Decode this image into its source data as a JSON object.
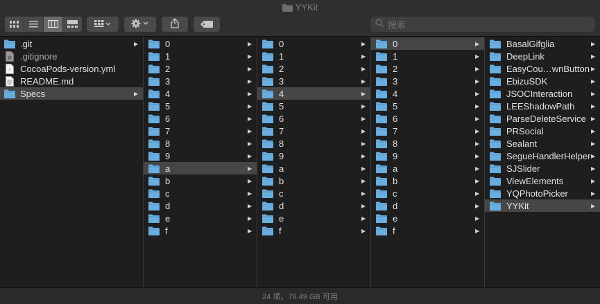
{
  "window": {
    "title": "YYKit"
  },
  "search": {
    "placeholder": "搜索"
  },
  "status": {
    "text": "24 项，76.49 GB 可用"
  },
  "columns": [
    {
      "items": [
        {
          "label": ".git",
          "type": "folder",
          "arrow": true,
          "dim": false,
          "selected": false
        },
        {
          "label": ".gitignore",
          "type": "hidden-file",
          "arrow": false,
          "dim": true,
          "selected": false
        },
        {
          "label": "CocoaPods-version.yml",
          "type": "file",
          "arrow": false,
          "dim": false,
          "selected": false
        },
        {
          "label": "README.md",
          "type": "doc",
          "arrow": false,
          "dim": false,
          "selected": false
        },
        {
          "label": "Specs",
          "type": "folder",
          "arrow": true,
          "dim": false,
          "selected": true
        }
      ]
    },
    {
      "items": [
        {
          "label": "0"
        },
        {
          "label": "1"
        },
        {
          "label": "2"
        },
        {
          "label": "3"
        },
        {
          "label": "4"
        },
        {
          "label": "5"
        },
        {
          "label": "6"
        },
        {
          "label": "7"
        },
        {
          "label": "8"
        },
        {
          "label": "9"
        },
        {
          "label": "a",
          "selected": true
        },
        {
          "label": "b"
        },
        {
          "label": "c"
        },
        {
          "label": "d"
        },
        {
          "label": "e"
        },
        {
          "label": "f"
        }
      ]
    },
    {
      "items": [
        {
          "label": "0"
        },
        {
          "label": "1"
        },
        {
          "label": "2"
        },
        {
          "label": "3"
        },
        {
          "label": "4",
          "selected": true
        },
        {
          "label": "5"
        },
        {
          "label": "6"
        },
        {
          "label": "7"
        },
        {
          "label": "8"
        },
        {
          "label": "9"
        },
        {
          "label": "a"
        },
        {
          "label": "b"
        },
        {
          "label": "c"
        },
        {
          "label": "d"
        },
        {
          "label": "e"
        },
        {
          "label": "f"
        }
      ]
    },
    {
      "items": [
        {
          "label": "0",
          "selected": true
        },
        {
          "label": "1"
        },
        {
          "label": "2"
        },
        {
          "label": "3"
        },
        {
          "label": "4"
        },
        {
          "label": "5"
        },
        {
          "label": "6"
        },
        {
          "label": "7"
        },
        {
          "label": "8"
        },
        {
          "label": "9"
        },
        {
          "label": "a"
        },
        {
          "label": "b"
        },
        {
          "label": "c"
        },
        {
          "label": "d"
        },
        {
          "label": "e"
        },
        {
          "label": "f"
        }
      ]
    },
    {
      "items": [
        {
          "label": "BasalGifglia"
        },
        {
          "label": "DeepLink"
        },
        {
          "label": "EasyCou…wnButton"
        },
        {
          "label": "EbizuSDK"
        },
        {
          "label": "JSOCInteraction"
        },
        {
          "label": "LEEShadowPath"
        },
        {
          "label": "ParseDeleteService"
        },
        {
          "label": "PRSocial"
        },
        {
          "label": "Sealant"
        },
        {
          "label": "SegueHandlerHelper"
        },
        {
          "label": "SJSlider"
        },
        {
          "label": "ViewElements"
        },
        {
          "label": "YQPhotoPicker"
        },
        {
          "label": "YYKit",
          "selected": true
        }
      ]
    }
  ],
  "colors": {
    "folder": "#6aaee0",
    "selection": "#464646",
    "background": "#1e1e1e"
  }
}
